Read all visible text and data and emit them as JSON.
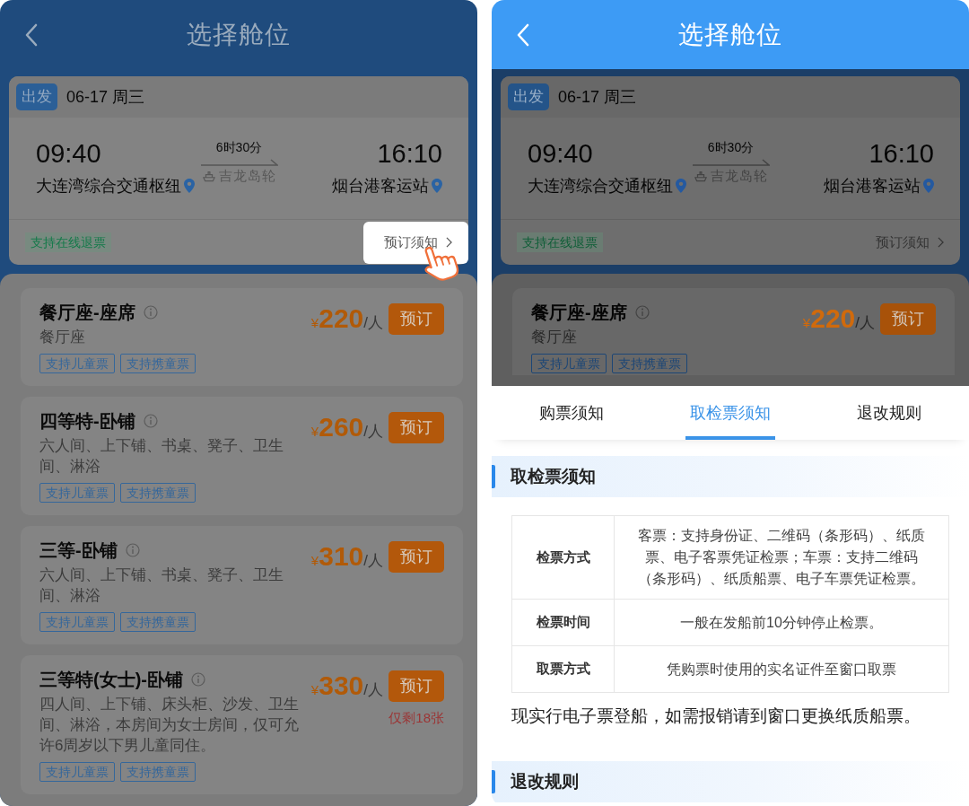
{
  "screens": [
    {
      "header": {
        "title": "选择舱位"
      },
      "trip": {
        "badge": "出发",
        "date": "06-17 周三",
        "departure_time": "09:40",
        "departure_station": "大连湾综合交通枢纽",
        "duration": "6时30分",
        "ship": "吉龙岛轮",
        "arrival_time": "16:10",
        "arrival_station": "烟台港客运站",
        "refund_tag": "支持在线退票",
        "notice_link": "预订须知",
        "notice_highlighted": true
      },
      "cabins": [
        {
          "name": "餐厅座-座席",
          "description": "餐厅座",
          "tags": [
            "支持儿童票",
            "支持携童票"
          ],
          "currency": "¥",
          "price": "220",
          "unit": "/人",
          "button": "预订"
        },
        {
          "name": "四等特-卧铺",
          "description": "六人间、上下铺、书桌、凳子、卫生间、淋浴",
          "tags": [
            "支持儿童票",
            "支持携童票"
          ],
          "currency": "¥",
          "price": "260",
          "unit": "/人",
          "button": "预订"
        },
        {
          "name": "三等-卧铺",
          "description": "六人间、上下铺、书桌、凳子、卫生间、淋浴",
          "tags": [
            "支持儿童票",
            "支持携童票"
          ],
          "currency": "¥",
          "price": "310",
          "unit": "/人",
          "button": "预订"
        },
        {
          "name": "三等特(女士)-卧铺",
          "description": "四人间、上下铺、床头柜、沙发、卫生间、淋浴，本房间为女士房间，仅可允许6周岁以下男儿童同住。",
          "tags": [
            "支持儿童票",
            "支持携童票"
          ],
          "currency": "¥",
          "price": "330",
          "unit": "/人",
          "button": "预订",
          "stock_note": "仅剩18张"
        }
      ]
    },
    {
      "header": {
        "title": "选择舱位"
      },
      "trip": {
        "badge": "出发",
        "date": "06-17 周三",
        "departure_time": "09:40",
        "departure_station": "大连湾综合交通枢纽",
        "duration": "6时30分",
        "ship": "吉龙岛轮",
        "arrival_time": "16:10",
        "arrival_station": "烟台港客运站",
        "refund_tag": "支持在线退票",
        "notice_link": "预订须知",
        "notice_highlighted": false
      },
      "cabins": [
        {
          "name": "餐厅座-座席",
          "description": "餐厅座",
          "tags": [
            "支持儿童票",
            "支持携童票"
          ],
          "currency": "¥",
          "price": "220",
          "unit": "/人",
          "button": "预订"
        }
      ],
      "sheet": {
        "tabs": [
          {
            "label": "购票须知",
            "selected": false
          },
          {
            "label": "取检票须知",
            "selected": true
          },
          {
            "label": "退改规则",
            "selected": false
          }
        ],
        "sections": [
          {
            "title": "取检票须知",
            "rows": [
              {
                "label": "检票方式",
                "value": "客票：支持身份证、二维码（条形码）、纸质票、电子客票凭证检票；车票：支持二维码（条形码）、纸质船票、电子车票凭证检票。"
              },
              {
                "label": "检票时间",
                "value": "一般在发船前10分钟停止检票。"
              },
              {
                "label": "取票方式",
                "value": "凭购票时使用的实名证件至窗口取票"
              }
            ],
            "note": "现实行电子票登船，如需报销请到窗口更换纸质船票。"
          },
          {
            "title": "退改规则"
          }
        ]
      }
    }
  ]
}
